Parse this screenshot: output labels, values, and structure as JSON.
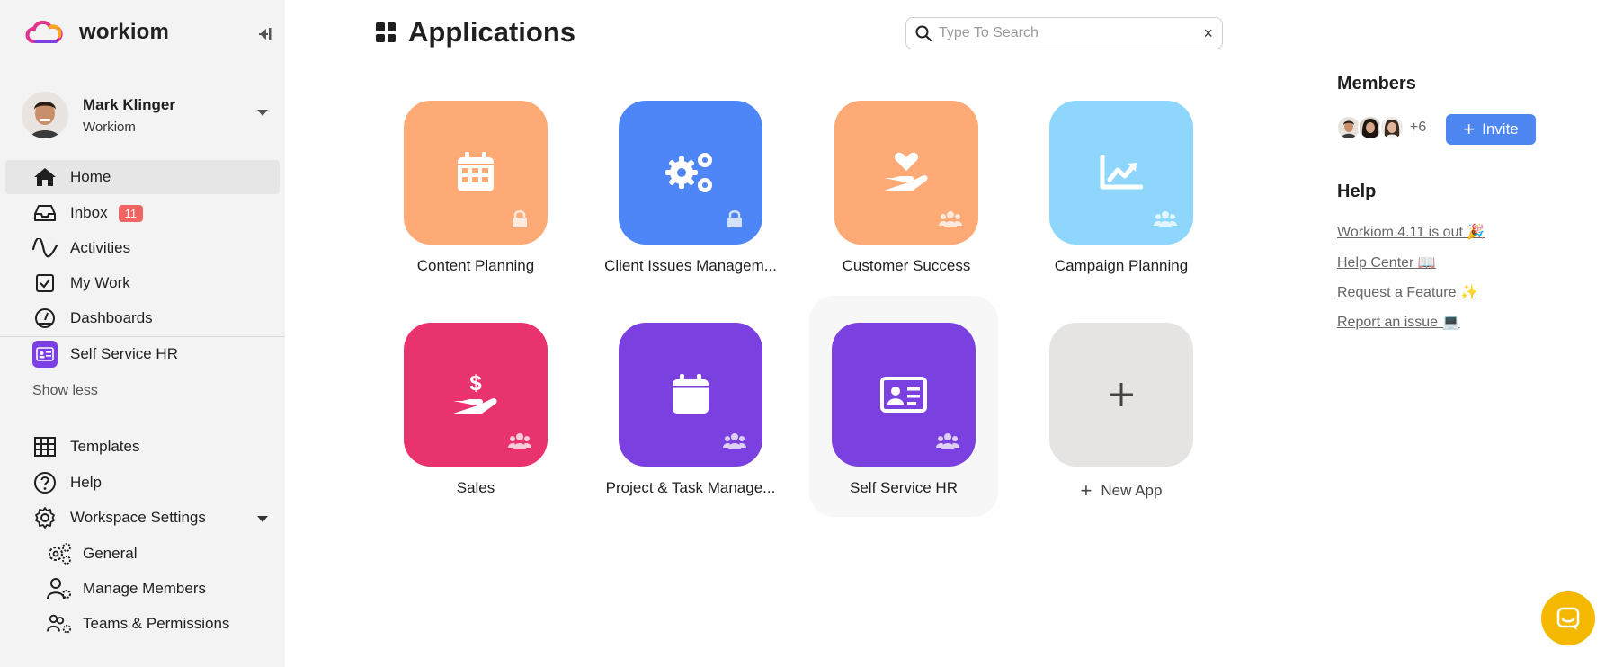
{
  "brand": {
    "name": "workiom"
  },
  "user": {
    "name": "Mark Klinger",
    "workspace": "Workiom"
  },
  "nav": {
    "home": "Home",
    "inbox": "Inbox",
    "inbox_count": "11",
    "activities": "Activities",
    "my_work": "My Work",
    "dashboards": "Dashboards",
    "self_service_hr": "Self Service HR",
    "show_less": "Show less",
    "templates": "Templates",
    "help": "Help",
    "workspace_settings": "Workspace Settings",
    "general": "General",
    "manage_members": "Manage Members",
    "teams_permissions": "Teams & Permissions"
  },
  "page": {
    "title": "Applications"
  },
  "search": {
    "placeholder": "Type To Search",
    "clear": "×"
  },
  "apps": [
    {
      "name": "Content Planning",
      "color": "#fdaa77",
      "icon": "calendar-icon",
      "corner": "lock-icon"
    },
    {
      "name": "Client Issues Managem...",
      "color": "#4f86f7",
      "icon": "gears-icon",
      "corner": "lock-icon"
    },
    {
      "name": "Customer Success",
      "color": "#fdaa77",
      "icon": "heart-hand-icon",
      "corner": "users-icon"
    },
    {
      "name": "Campaign Planning",
      "color": "#8fd6fd",
      "icon": "chart-line-icon",
      "corner": "users-icon"
    },
    {
      "name": "Sales",
      "color": "#e9336f",
      "icon": "dollar-hand-icon",
      "corner": "users-icon"
    },
    {
      "name": "Project & Task Manage...",
      "color": "#7b40e0",
      "icon": "calendar-icon",
      "corner": "users-icon"
    },
    {
      "name": "Self Service HR",
      "color": "#7b40e0",
      "icon": "id-card-icon",
      "corner": "users-icon"
    }
  ],
  "new_app": {
    "label": "New App",
    "plus": "+",
    "color": "#e6e4e2"
  },
  "members": {
    "title": "Members",
    "more": "+6",
    "invite": "Invite",
    "plus": "+"
  },
  "help": {
    "title": "Help",
    "links": [
      "Workiom 4.11 is out 🎉",
      "Help Center 📖",
      "Request a Feature ✨",
      "Report an issue 💻"
    ]
  },
  "colors": {
    "accent": "#4e86f2",
    "chat": "#f5b800",
    "badge": "#f06464"
  }
}
